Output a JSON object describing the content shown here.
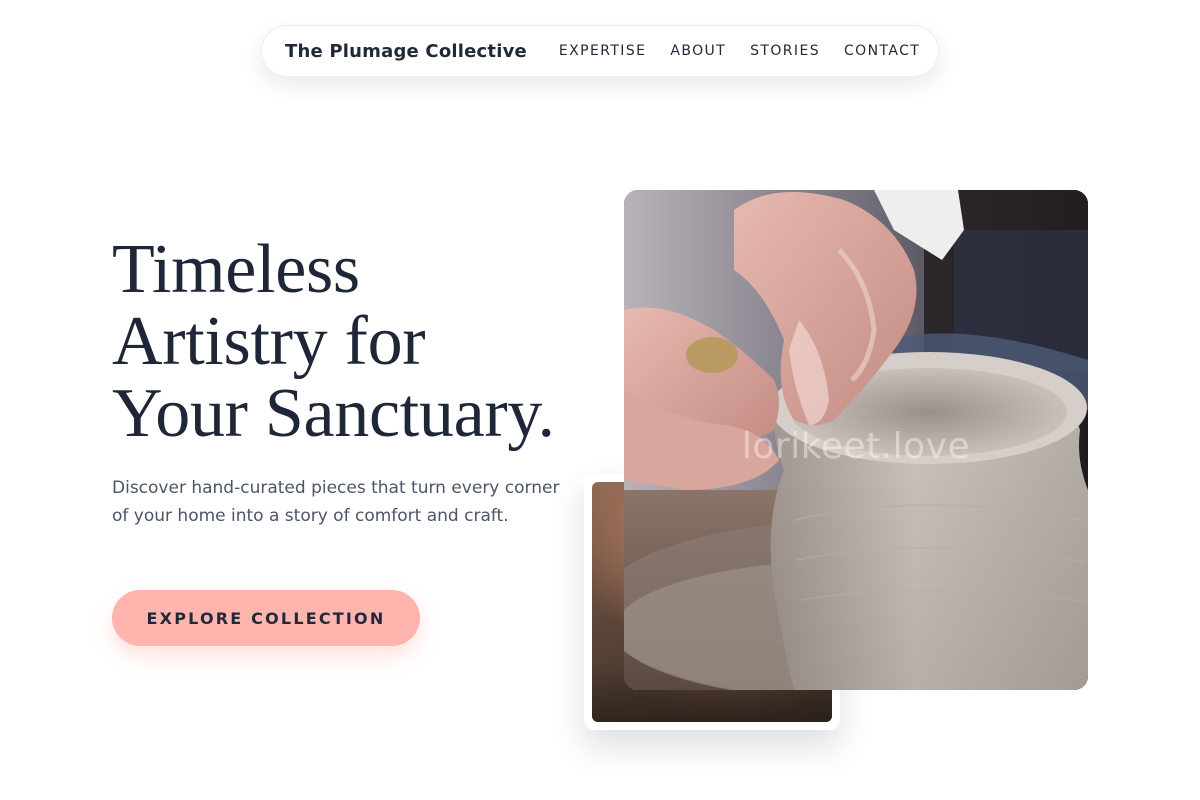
{
  "nav": {
    "brand": "The Plumage Collective",
    "links": [
      {
        "label": "EXPERTISE"
      },
      {
        "label": "ABOUT"
      },
      {
        "label": "STORIES"
      },
      {
        "label": "CONTACT"
      }
    ]
  },
  "hero": {
    "headline_lines": [
      "Timeless",
      "Artistry for",
      "Your Sanctuary."
    ],
    "subtext": "Discover hand-curated pieces that turn every corner of your home into a story of comfort and craft.",
    "cta_label": "EXPLORE COLLECTION"
  },
  "images": {
    "main_alt": "Hands shaping a clay vase on a pottery wheel",
    "main_watermark": "lorikeet.love",
    "secondary_alt": "Close-up of pottery wheel"
  },
  "colors": {
    "accent": "#ffb4ae",
    "text_dark": "#1e2638",
    "text_muted": "#4b5566"
  }
}
